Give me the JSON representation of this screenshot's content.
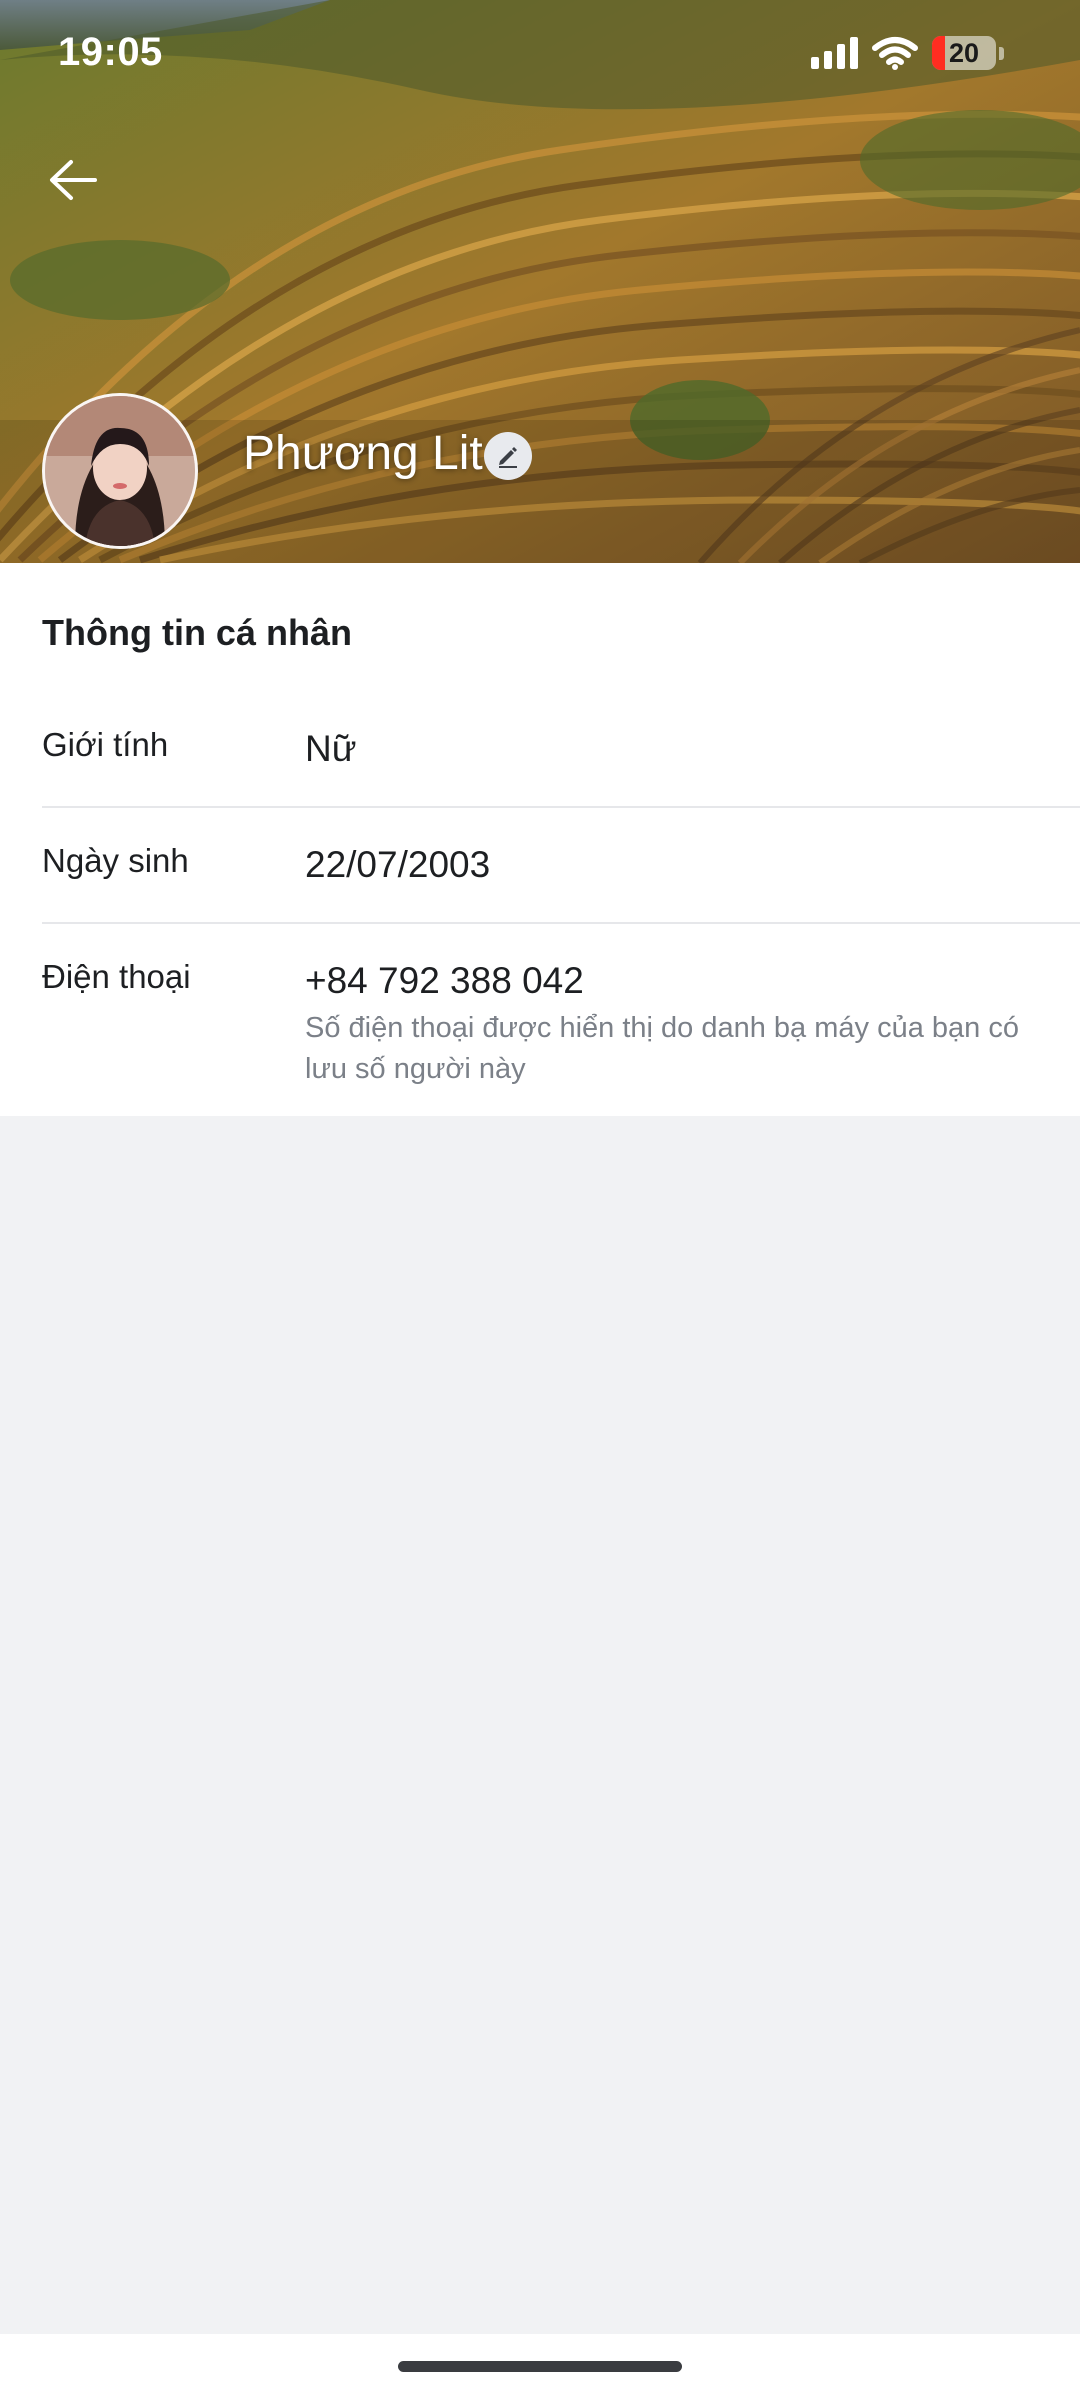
{
  "status_bar": {
    "time": "19:05",
    "battery": "20",
    "icons": [
      "signal-icon",
      "wifi-icon",
      "battery-icon"
    ]
  },
  "header": {
    "back_icon": "arrow-left-icon",
    "name": "Phương Lit",
    "edit_icon": "pencil-icon"
  },
  "personal_info": {
    "title": "Thông tin cá nhân",
    "rows": [
      {
        "label": "Giới tính",
        "value": "Nữ"
      },
      {
        "label": "Ngày sinh",
        "value": "22/07/2003"
      },
      {
        "label": "Điện thoại",
        "value": "+84 792 388 042",
        "note": "Số điện thoại được hiển thị do danh bạ máy của bạn có lưu số người này"
      }
    ]
  },
  "colors": {
    "accent_text": "#1d1f22",
    "muted_text": "#7b8088",
    "page_bg": "#f1f2f4",
    "battery_low": "#ff2d21"
  }
}
